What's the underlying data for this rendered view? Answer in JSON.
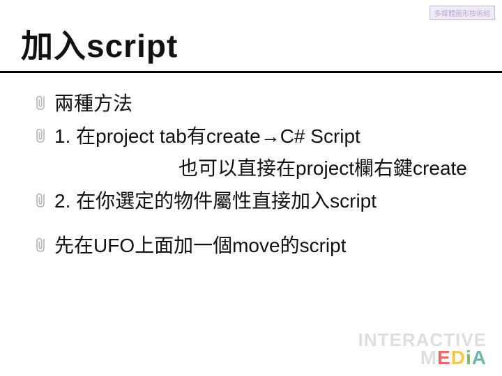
{
  "top_badge": "多媒體圖形技術組",
  "title": "加入script",
  "bullets": {
    "b1": "兩種方法",
    "b2": "1. 在project tab有create→C# Script",
    "indent": "也可以直接在project欄右鍵create",
    "b3": "2. 在你選定的物件屬性直接加入script",
    "b4": "先在UFO上面加一個move的script"
  },
  "footer": {
    "line1": "INTERACTIVE",
    "m": "M",
    "e": "E",
    "d": "D",
    "a": "A"
  }
}
